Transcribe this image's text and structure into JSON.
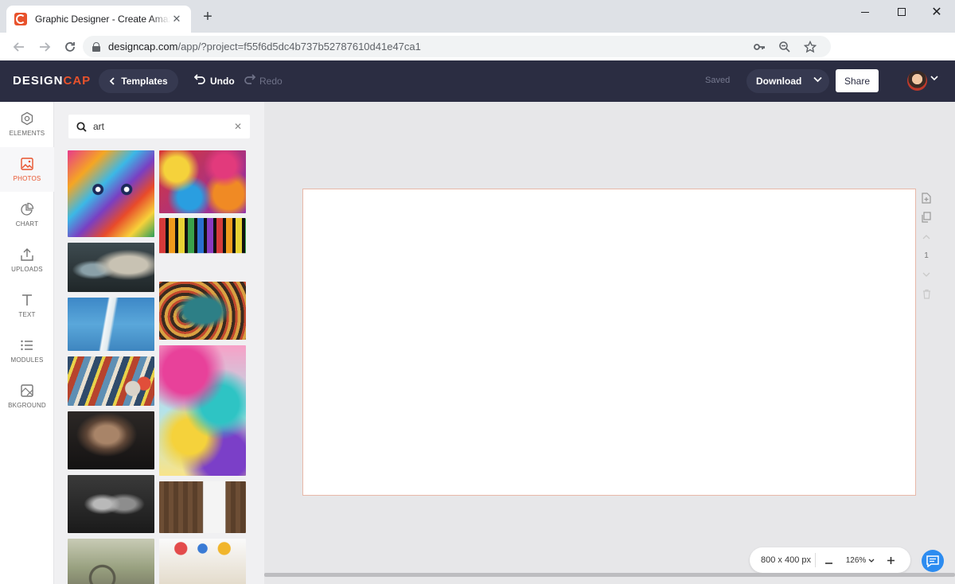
{
  "browser": {
    "tab_title": "Graphic Designer - Create Amazing Graphics",
    "tab_close": "✕",
    "new_tab": "+",
    "url_host": "designcap.com",
    "url_path": "/app/?project=f55f6d5dc4b737b52787610d41e47ca1",
    "window_close": "✕"
  },
  "app": {
    "logo_main": "DESIGN",
    "logo_accent": "CAP",
    "templates_label": "Templates",
    "undo_label": "Undo",
    "redo_label": "Redo",
    "saved_label": "Saved",
    "download_label": "Download",
    "share_label": "Share",
    "accent_color": "#e8522c",
    "header_color": "#2b2d42"
  },
  "rail": {
    "items": [
      {
        "label": "ELEMENTS",
        "icon": "hexagon-icon"
      },
      {
        "label": "PHOTOS",
        "icon": "photo-icon"
      },
      {
        "label": "CHART",
        "icon": "pie-chart-icon"
      },
      {
        "label": "UPLOADS",
        "icon": "upload-icon"
      },
      {
        "label": "TEXT",
        "icon": "text-icon"
      },
      {
        "label": "MODULES",
        "icon": "list-icon"
      },
      {
        "label": "BKGROUND",
        "icon": "background-icon"
      }
    ],
    "active": "PHOTOS"
  },
  "photos": {
    "search_value": "art",
    "clear_glyph": "✕"
  },
  "canvas": {
    "size_label": "800 x 400 px",
    "zoom_label": "126%",
    "page_number": "1"
  }
}
